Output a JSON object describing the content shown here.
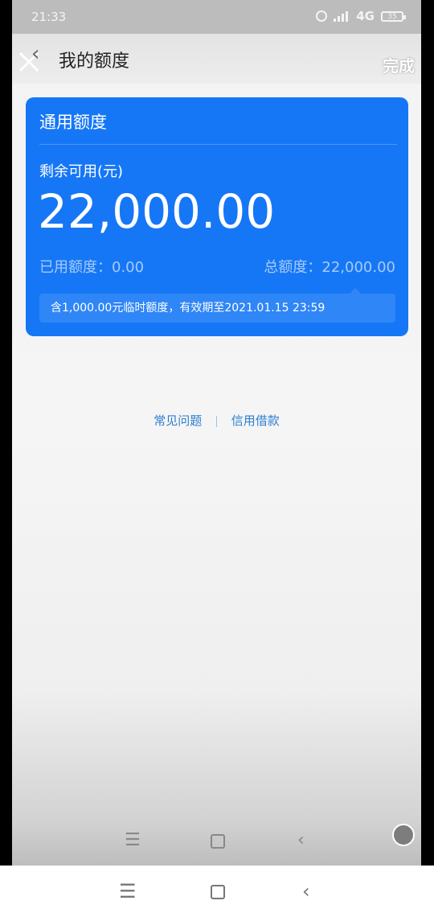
{
  "status_bar": {
    "time": "21:33",
    "network": "4G",
    "battery": "35"
  },
  "header": {
    "title": "我的额度",
    "done_label": "完成"
  },
  "credit_card": {
    "title": "通用额度",
    "remaining_label": "剩余可用(元)",
    "remaining_amount": "22,000.00",
    "used_label": "已用额度：0.00",
    "total_label": "总额度：22,000.00",
    "temp_notice": "含1,000.00元临时额度，有效期至2021.01.15 23:59",
    "color": "#1677f6"
  },
  "links": {
    "faq": "常见问题",
    "credit_loan": "信用借款"
  },
  "icons": {
    "close": "close-icon",
    "menu": "menu-icon",
    "home": "home-icon",
    "back": "back-icon"
  }
}
